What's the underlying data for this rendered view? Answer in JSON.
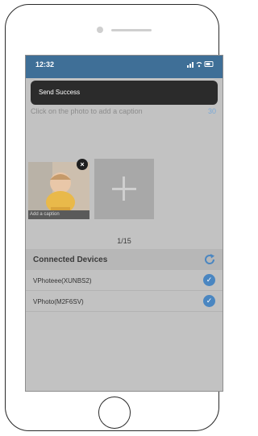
{
  "status": {
    "time": "12:32",
    "icons": "••ll ≋ ▭"
  },
  "toast": {
    "text": "Send Success"
  },
  "caption": {
    "hint": "Click on the photo to add a caption",
    "count": "30"
  },
  "photo": {
    "caption_placeholder": "Add a caption",
    "close_glyph": "×"
  },
  "pager": {
    "text": "1/15"
  },
  "devices": {
    "title": "Connected Devices",
    "items": [
      {
        "name": "VPhoteee(XUNBS2)",
        "checked": true
      },
      {
        "name": "VPhoto(M2F6SV)",
        "checked": true
      }
    ]
  },
  "colors": {
    "accent": "#4a86c1",
    "status_bar": "#3f6f97"
  }
}
